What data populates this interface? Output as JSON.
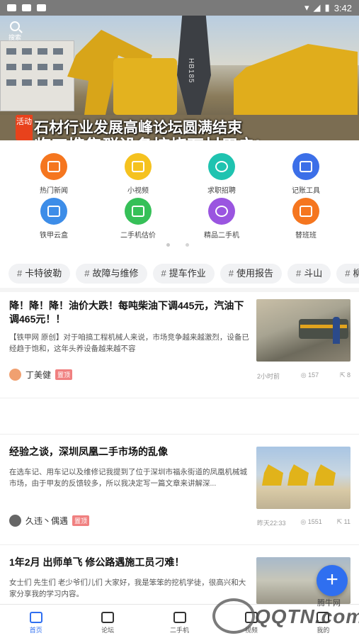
{
  "status_bar": {
    "time": "3:42"
  },
  "banner": {
    "search_label": "搜索",
    "tag": "活动",
    "title": "石材行业发展高峰论坛圆满结束",
    "subtitle": "临工携集群设备控烧石材用户!",
    "machine_text": "HB185"
  },
  "categories": [
    {
      "label": "热门新闻",
      "icon": "newspaper-icon",
      "color": "#f5761f"
    },
    {
      "label": "小视频",
      "icon": "video-icon",
      "color": "#f5c21f"
    },
    {
      "label": "求职招聘",
      "icon": "person-icon",
      "color": "#1fc3b0"
    },
    {
      "label": "记账工具",
      "icon": "ledger-icon",
      "color": "#3c6fe8"
    },
    {
      "label": "铁甲云盒",
      "icon": "cloud-box-icon",
      "color": "#3d8de8"
    },
    {
      "label": "二手机估价",
      "icon": "scale-icon",
      "color": "#36c058"
    },
    {
      "label": "精品二手机",
      "icon": "yen-cycle-icon",
      "color": "#9a55e0"
    },
    {
      "label": "替班班",
      "icon": "shift-icon",
      "color": "#f5761f"
    }
  ],
  "topic_tags": [
    "卡特彼勒",
    "故障与维修",
    "提车作业",
    "使用报告",
    "斗山",
    "柳工"
  ],
  "articles": [
    {
      "title": "降！降！降！油价大跌！每吨柴油下调445元，汽油下调465元！！",
      "desc": "【铁甲网 原创】对于咱搞工程机械人来说，市场竞争越来越激烈，设备已经趋于饱和，这年头养设备越来越不容",
      "author": "丁美健",
      "badge": "置顶",
      "time": "2小时前",
      "views": "157",
      "shares": "8"
    },
    {
      "title": "经验之谈，深圳凤凰二手市场的乱像",
      "desc": "在选车记、用车记以及维修记我提到了位于深圳市福永街道的凤凰机械城市场，由于甲友的反馈较多，所以我决定写一篇文章来讲解深...",
      "author": "久违丶偶遇",
      "badge": "置顶",
      "time": "昨天22:33",
      "views": "1551",
      "shares": "11"
    },
    {
      "title": "1年2月 出师单飞 修公路遇施工员刁难！",
      "desc": "女士们 先生们 老少爷们儿们 大家好，我是笨笨的挖机学徒，很高兴和大家分享我的学习内容。"
    }
  ],
  "tabs": [
    "首页",
    "论坛",
    "二手机",
    "视频",
    "我的"
  ],
  "watermark": {
    "brand": "QQTN.com",
    "small": "腾牛网"
  },
  "fab_label": "+"
}
